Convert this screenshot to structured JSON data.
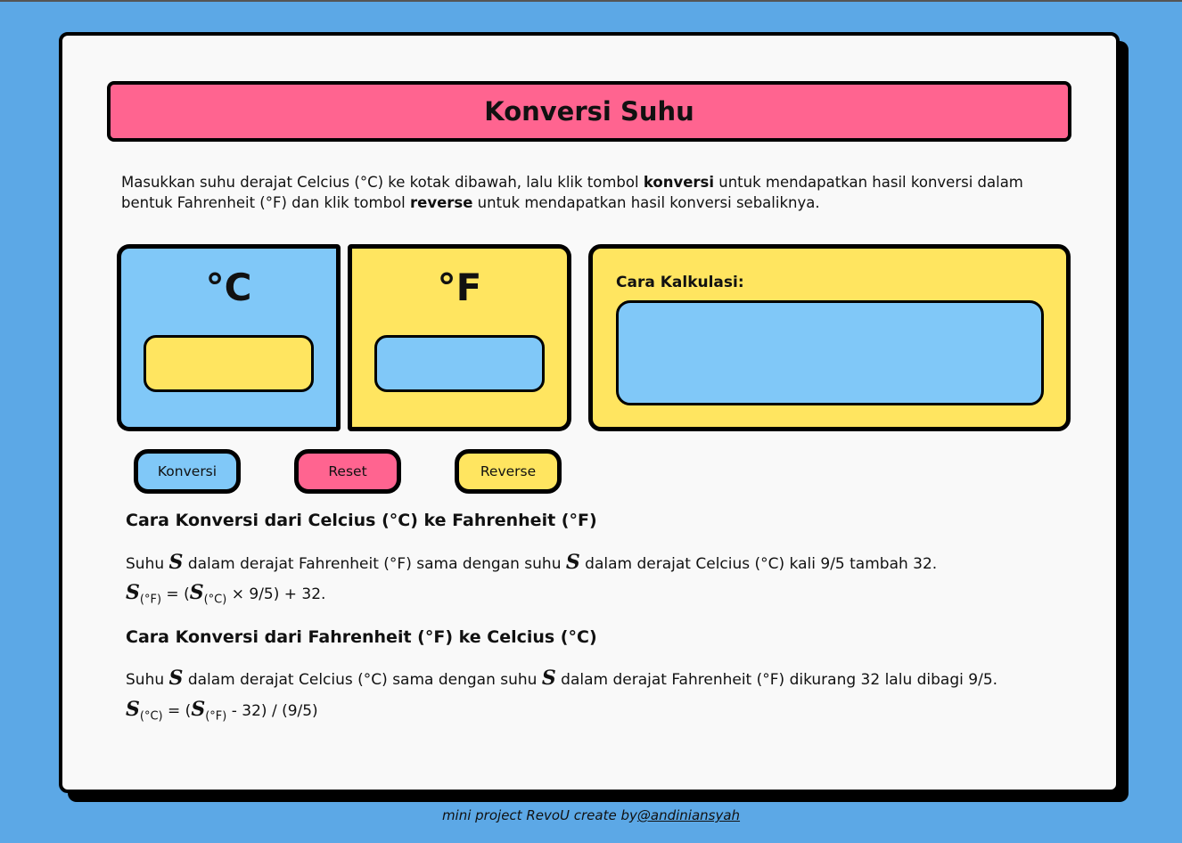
{
  "page": {
    "title": "Konversi Suhu"
  },
  "intro": {
    "part1": "Masukkan suhu derajat Celcius (°C) ke kotak dibawah, lalu klik tombol ",
    "bold1": "konversi",
    "part2": " untuk mendapatkan hasil konversi dalam bentuk Fahrenheit (°F) dan klik tombol ",
    "bold2": "reverse",
    "part3": " untuk mendapatkan hasil konversi sebaliknya."
  },
  "converter": {
    "celsius_label": "°C",
    "celsius_value": "",
    "fahrenheit_label": "°F",
    "fahrenheit_value": "",
    "calc_label": "Cara Kalkulasi:",
    "calc_value": ""
  },
  "buttons": {
    "konversi": "Konversi",
    "reset": "Reset",
    "reverse": "Reverse"
  },
  "section_c_to_f": {
    "title": "Cara Konversi dari Celcius (°C) ke Fahrenheit (°F)",
    "desc_pre": "Suhu ",
    "symbol": "S",
    "desc_mid": " dalam derajat Fahrenheit (°F) sama dengan suhu ",
    "desc_post": " dalam derajat Celcius (°C) kali 9/5 tambah 32.",
    "f_lhs_sub": "(°F)",
    "f_eq": " = (",
    "f_rhs_sub": "(°C)",
    "f_tail": " × 9/5) + 32."
  },
  "section_f_to_c": {
    "title": "Cara Konversi dari Fahrenheit (°F) ke Celcius (°C)",
    "desc_pre": "Suhu ",
    "symbol": "S",
    "desc_mid": " dalam derajat Celcius (°C) sama dengan suhu ",
    "desc_post": " dalam derajat Fahrenheit (°F) dikurang 32 lalu dibagi 9/5.",
    "f_lhs_sub": "(°C)",
    "f_eq": " = (",
    "f_rhs_sub": "(°F)",
    "f_tail": " - 32) / (9/5)"
  },
  "footer": {
    "text": "mini project RevoU create by",
    "link": "@andiniansyah"
  },
  "colors": {
    "background": "#5ca8e6",
    "pink": "#ff6490",
    "blue": "#80c8f8",
    "yellow": "#ffe560"
  }
}
